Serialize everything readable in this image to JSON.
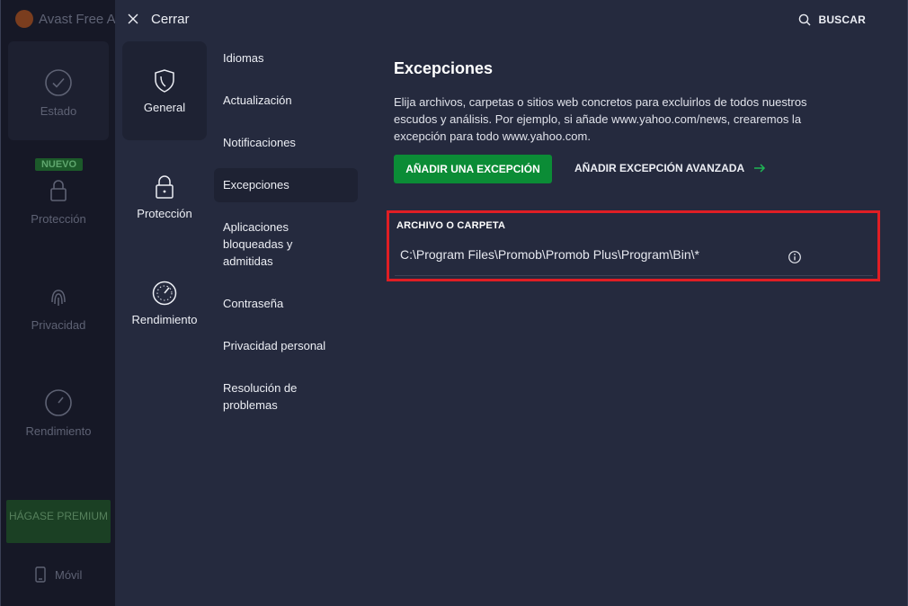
{
  "background_app": {
    "title": "Avast Free A",
    "nav": [
      {
        "label": "Estado",
        "icon": "check-circle-icon"
      },
      {
        "label": "Protección",
        "icon": "lock-icon"
      },
      {
        "label": "Privacidad",
        "icon": "fingerprint-icon"
      },
      {
        "label": "Rendimiento",
        "icon": "speedometer-icon"
      }
    ],
    "new_badge": "NUEVO",
    "premium_button": "HÁGASE PREMIUM",
    "mobile_label": "Móvil"
  },
  "settings": {
    "close_label": "Cerrar",
    "search_label": "BUSCAR",
    "categories": [
      {
        "label": "General",
        "icon": "shield-icon",
        "active": true
      },
      {
        "label": "Protección",
        "icon": "lock-icon",
        "active": false
      },
      {
        "label": "Rendimiento",
        "icon": "speedometer-icon",
        "active": false
      }
    ],
    "subnav": [
      {
        "label": "Idiomas"
      },
      {
        "label": "Actualización"
      },
      {
        "label": "Notificaciones"
      },
      {
        "label": "Excepciones",
        "active": true
      },
      {
        "label": "Aplicaciones bloqueadas y admitidas"
      },
      {
        "label": "Contraseña"
      },
      {
        "label": "Privacidad personal"
      },
      {
        "label": "Resolución de problemas"
      }
    ],
    "content": {
      "title": "Excepciones",
      "description": "Elija archivos, carpetas o sitios web concretos para excluirlos de todos nuestros escudos y análisis. Por ejemplo, si añade www.yahoo.com/news, crearemos la excepción para todo www.yahoo.com.",
      "add_button": "AÑADIR UNA EXCEPCIÓN",
      "add_advanced": "AÑADIR EXCEPCIÓN AVANZADA",
      "column_header": "ARCHIVO O CARPETA",
      "exceptions": [
        {
          "path": "C:\\Program Files\\Promob\\Promob Plus\\Program\\Bin\\*"
        }
      ]
    }
  },
  "colors": {
    "panel_bg": "#252a3e",
    "sidebar_bg": "#161826",
    "accent_green": "#0b8c36",
    "highlight_red": "#e01e24"
  }
}
